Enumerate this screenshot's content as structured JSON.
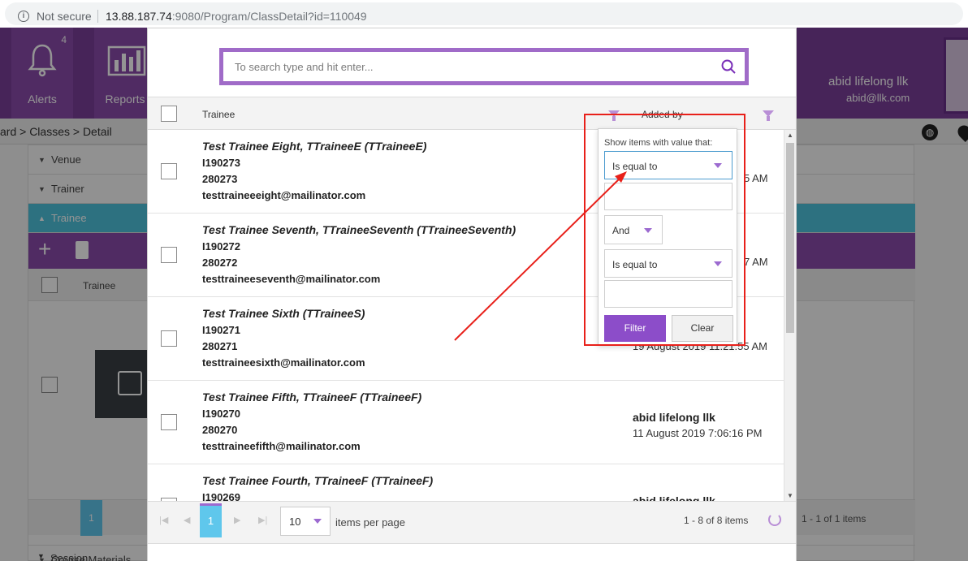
{
  "browser": {
    "security_label": "Not secure",
    "url_host": "13.88.187.74",
    "url_rest": ":9080/Program/ClassDetail?id=110049"
  },
  "app": {
    "nav": [
      {
        "label": "Alerts",
        "count": "4",
        "icon": "bell-icon"
      },
      {
        "label": "Reports",
        "icon": "bar-chart-icon"
      }
    ],
    "user_name": "abid lifelong llk",
    "user_email": "abid@llk.com",
    "breadcrumb": "ard > Classes > Detail",
    "sections": [
      "Venue",
      "Trainer",
      "Trainee",
      "Course Materials",
      "Session"
    ],
    "inner_grid_header": "Trainee",
    "inner_pager_page": "1",
    "inner_pager_info": "1 - 1 of 1 items"
  },
  "modal": {
    "search_placeholder": "To search type and hit enter...",
    "columns": {
      "trainee": "Trainee",
      "added_by": "Added by"
    },
    "rows": [
      {
        "name": "Test Trainee Eight, TTraineeE (TTraineeE)",
        "id": "I190273",
        "num": "280273",
        "email": "testtraineeeight@mailinator.com",
        "added_by": "",
        "date": "5 AM"
      },
      {
        "name": "Test Trainee Seventh, TTraineeSeventh (TTraineeSeventh)",
        "id": "I190272",
        "num": "280272",
        "email": "testtraineeseventh@mailinator.com",
        "added_by": "",
        "date": "7 AM"
      },
      {
        "name": "Test Trainee Sixth (TTraineeS)",
        "id": "I190271",
        "num": "280271",
        "email": "testtraineesixth@mailinator.com",
        "added_by": "",
        "date": "19 August 2019 11:21:55 AM"
      },
      {
        "name": "Test Trainee Fifth, TTraineeF (TTraineeF)",
        "id": "I190270",
        "num": "280270",
        "email": "testtraineefifth@mailinator.com",
        "added_by": "abid lifelong llk",
        "date": "11 August 2019 7:06:16 PM"
      },
      {
        "name": "Test Trainee Fourth, TTraineeF (TTraineeF)",
        "id": "I190269",
        "num": "",
        "email": "",
        "added_by": "abid lifelong llk",
        "date": ""
      }
    ],
    "pager": {
      "current_page": "1",
      "page_size": "10",
      "items_per_page_label": "items per page",
      "info": "1 - 8 of 8 items"
    }
  },
  "filter": {
    "title": "Show items with value that:",
    "operator1": "Is equal to",
    "logic": "And",
    "operator2": "Is equal to",
    "filter_label": "Filter",
    "clear_label": "Clear"
  },
  "colors": {
    "brand_purple": "#7b3f99",
    "accent_purple": "#8c4dc9",
    "pager_blue": "#5fc7ec",
    "annotation_red": "#e8201a"
  }
}
